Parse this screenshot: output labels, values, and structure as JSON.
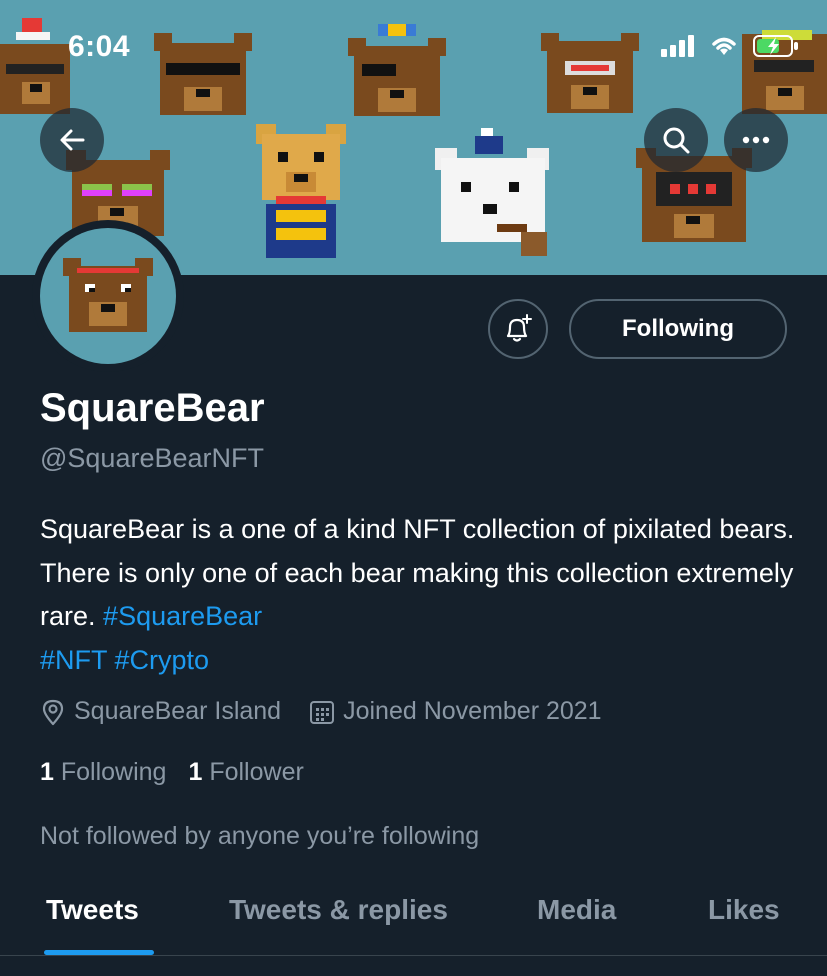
{
  "status_bar": {
    "time": "6:04"
  },
  "profile": {
    "name": "SquareBear",
    "handle": "@SquareBearNFT",
    "bio": {
      "text": "SquareBear is a one of a kind NFT collection of pixilated bears. There is only one of each bear making this collection extremely rare.",
      "hashtags": [
        "#SquareBear",
        "#NFT",
        "#Crypto"
      ]
    },
    "location": "SquareBear Island",
    "joined": "Joined November 2021",
    "following_count": "1",
    "following_label": "Following",
    "followers_count": "1",
    "followers_label": "Follower",
    "not_followed_text": "Not followed by anyone you’re following"
  },
  "actions": {
    "following_button": "Following"
  },
  "tabs": [
    {
      "label": "Tweets",
      "active": true
    },
    {
      "label": "Tweets & replies",
      "active": false
    },
    {
      "label": "Media",
      "active": false
    },
    {
      "label": "Likes",
      "active": false
    }
  ],
  "icons": {
    "back": "back-arrow-icon",
    "search": "search-icon",
    "more": "more-icon",
    "notify": "bell-plus-icon",
    "location": "location-pin-icon",
    "calendar": "calendar-icon"
  },
  "colors": {
    "background": "#15202b",
    "banner": "#5aa0b0",
    "accent": "#1d9bf0",
    "secondary_text": "#8b98a5",
    "border": "#536471"
  }
}
